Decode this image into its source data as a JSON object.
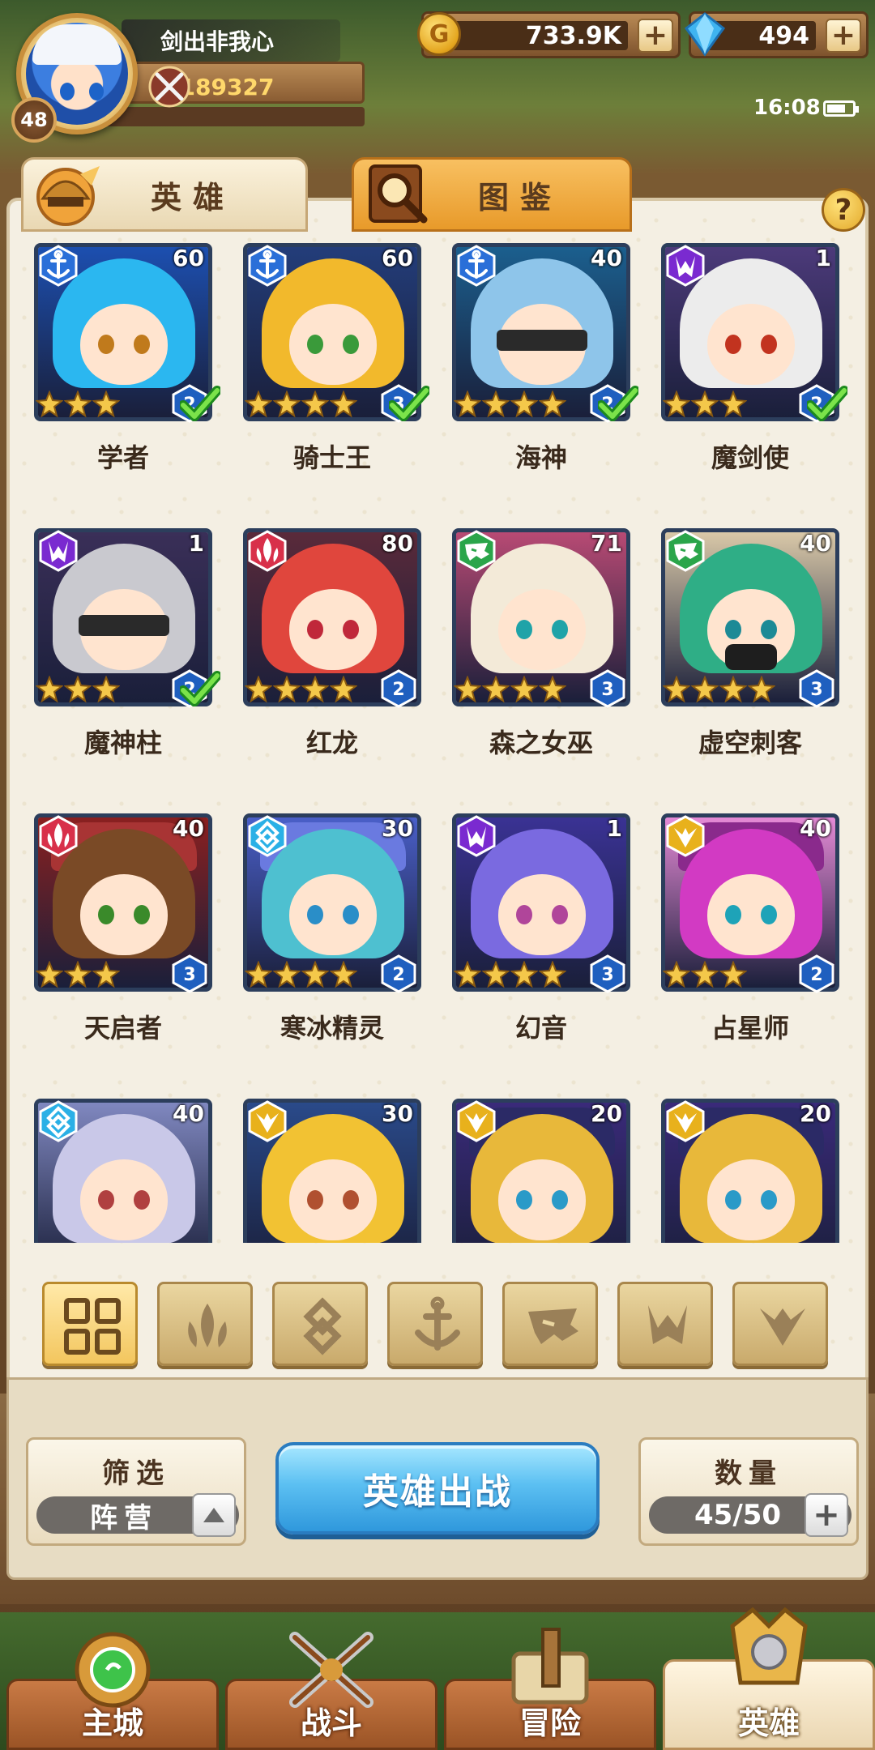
{
  "player": {
    "name": "剑出非我心",
    "level": "48",
    "power": "189327"
  },
  "resources": {
    "gold": "733.9K",
    "diamonds": "494"
  },
  "status": {
    "time": "16:08"
  },
  "tabs": {
    "heroes": "英雄",
    "codex": "图鉴"
  },
  "help_label": "?",
  "heroes": [
    {
      "name": "学者",
      "level": "60",
      "stars": 3,
      "rank": "2",
      "faction": "anchor",
      "checked": true,
      "hair": "#2bb7f0",
      "eyes": "#c07a1c",
      "bg": "#1c4fb0"
    },
    {
      "name": "骑士王",
      "level": "60",
      "stars": 4,
      "rank": "3",
      "faction": "anchor",
      "checked": true,
      "hair": "#f2b92c",
      "eyes": "#3a9a3a",
      "bg": "#233d7a"
    },
    {
      "name": "海神",
      "level": "40",
      "stars": 4,
      "rank": "2",
      "faction": "anchor",
      "checked": true,
      "hair": "#8ec5ea",
      "eyes": "#333333",
      "bg": "#1b5f8e",
      "masked": true
    },
    {
      "name": "魔剑使",
      "level": "1",
      "stars": 3,
      "rank": "2",
      "faction": "shadow",
      "checked": true,
      "hair": "#ececec",
      "eyes": "#c2331f",
      "bg": "#4c3a7a"
    },
    {
      "name": "魔神柱",
      "level": "1",
      "stars": 3,
      "rank": "2",
      "faction": "shadow",
      "checked": true,
      "hair": "#c9c9cf",
      "eyes": "#333333",
      "bg": "#3a2f58",
      "masked": true
    },
    {
      "name": "红龙",
      "level": "80",
      "stars": 4,
      "rank": "2",
      "faction": "fire",
      "checked": false,
      "hair": "#e0463d",
      "eyes": "#c0283a",
      "bg": "#5a2a3a"
    },
    {
      "name": "森之女巫",
      "level": "71",
      "stars": 4,
      "rank": "3",
      "faction": "beast",
      "checked": false,
      "hair": "#f3ead8",
      "eyes": "#1fa3a8",
      "bg": "#b84a74"
    },
    {
      "name": "虚空刺客",
      "level": "40",
      "stars": 4,
      "rank": "3",
      "faction": "beast",
      "checked": false,
      "hair": "#2fae86",
      "eyes": "#1c8a96",
      "bg": "#d9c8a8",
      "mouthmask": true
    },
    {
      "name": "天启者",
      "level": "40",
      "stars": 3,
      "rank": "3",
      "faction": "fire",
      "checked": false,
      "hair": "#7a4a26",
      "eyes": "#3a8a2a",
      "bg": "#8a2020",
      "hat": "#a83434"
    },
    {
      "name": "寒冰精灵",
      "level": "30",
      "stars": 4,
      "rank": "2",
      "faction": "ice",
      "checked": false,
      "hair": "#4ec0d0",
      "eyes": "#2a8ec8",
      "bg": "#4a5fc8",
      "hat": "#6a7ae0"
    },
    {
      "name": "幻音",
      "level": "1",
      "stars": 4,
      "rank": "3",
      "faction": "shadow",
      "checked": false,
      "hair": "#7a6ae0",
      "eyes": "#b0459a",
      "bg": "#3a3294"
    },
    {
      "name": "占星师",
      "level": "40",
      "stars": 3,
      "rank": "2",
      "faction": "light",
      "checked": false,
      "hair": "#d23ac3",
      "eyes": "#1ea3b8",
      "bg": "#e58ad6",
      "hat": "#8a2a8c"
    },
    {
      "name": "",
      "level": "40",
      "stars": 0,
      "rank": "",
      "faction": "ice",
      "checked": false,
      "hair": "#c9c8e8",
      "eyes": "#b04040",
      "bg": "#8088c0"
    },
    {
      "name": "",
      "level": "30",
      "stars": 0,
      "rank": "",
      "faction": "light",
      "checked": false,
      "hair": "#f2c233",
      "eyes": "#b05030",
      "bg": "#2a4a8a"
    },
    {
      "name": "",
      "level": "20",
      "stars": 0,
      "rank": "",
      "faction": "light",
      "checked": false,
      "hair": "#e8b83a",
      "eyes": "#2a9ac8",
      "bg": "#3a2a7a",
      "hat": "#2b2a66"
    },
    {
      "name": "",
      "level": "20",
      "stars": 0,
      "rank": "",
      "faction": "light",
      "checked": false,
      "hair": "#e8b83a",
      "eyes": "#2a9ac8",
      "bg": "#3a2a7a",
      "hat": "#2b2a66"
    }
  ],
  "faction_filters": [
    "all-filter",
    "fire-filter",
    "ice-filter",
    "anchor-filter",
    "beast-filter",
    "shadow-filter",
    "light-filter"
  ],
  "controls": {
    "filter_title": "筛选",
    "filter_value": "阵营",
    "deploy_label": "英雄出战",
    "count_title": "数量",
    "count_value": "45/50"
  },
  "nav": [
    {
      "id": "main-city",
      "label": "主城",
      "active": false
    },
    {
      "id": "battle",
      "label": "战斗",
      "active": false
    },
    {
      "id": "adventure",
      "label": "冒险",
      "active": false
    },
    {
      "id": "heroes",
      "label": "英雄",
      "active": true
    }
  ],
  "colors": {
    "faction_anchor": "#2a6fd8",
    "faction_shadow": "#7a2ad0",
    "faction_fire": "#d8304a",
    "faction_beast": "#2aa54a",
    "faction_ice": "#2ab0e6",
    "faction_light": "#e8b11c"
  }
}
